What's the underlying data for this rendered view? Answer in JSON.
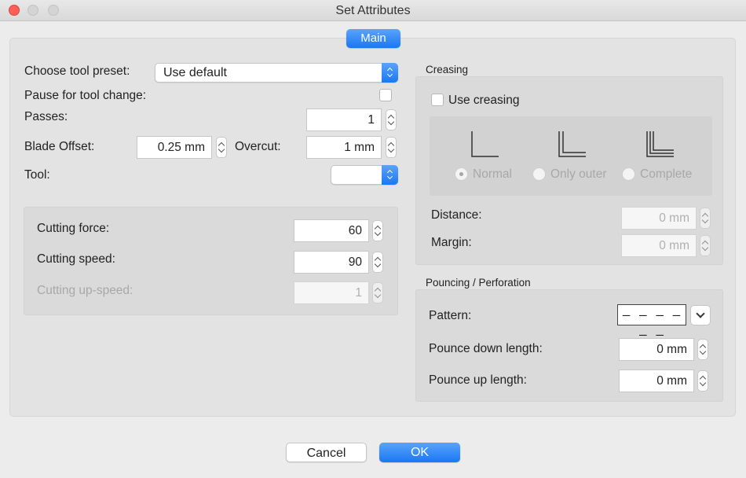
{
  "window": {
    "title": "Set Attributes"
  },
  "tabs": [
    {
      "label": "Main",
      "selected": true
    }
  ],
  "tool": {
    "preset_label": "Choose tool preset:",
    "preset_value": "Use default",
    "pause_label": "Pause for tool change:",
    "pause_checked": false,
    "passes_label": "Passes:",
    "passes_value": "1",
    "blade_offset_label": "Blade Offset:",
    "blade_offset_value": "0.25 mm",
    "overcut_label": "Overcut:",
    "overcut_value": "1 mm",
    "tool_label": "Tool:",
    "tool_value": ""
  },
  "cutting": {
    "force_label": "Cutting force:",
    "force_value": "60",
    "speed_label": "Cutting speed:",
    "speed_value": "90",
    "upspeed_label": "Cutting up-speed:",
    "upspeed_value": "1"
  },
  "creasing": {
    "title": "Creasing",
    "use_label": "Use creasing",
    "use_checked": false,
    "options": [
      {
        "label": "Normal",
        "selected": true,
        "icon": "crease-normal-icon"
      },
      {
        "label": "Only outer",
        "selected": false,
        "icon": "crease-outer-icon"
      },
      {
        "label": "Complete",
        "selected": false,
        "icon": "crease-complete-icon"
      }
    ],
    "distance_label": "Distance:",
    "distance_value": "0 mm",
    "margin_label": "Margin:",
    "margin_value": "0 mm"
  },
  "pouncing": {
    "title": "Pouncing / Perforation",
    "pattern_label": "Pattern:",
    "pattern_value": "– – – – – –",
    "down_label": "Pounce down length:",
    "down_value": "0 mm",
    "up_label": "Pounce up length:",
    "up_value": "0 mm"
  },
  "buttons": {
    "cancel": "Cancel",
    "ok": "OK"
  },
  "colors": {
    "accent": "#1a78f2",
    "close": "#fe5f57"
  }
}
